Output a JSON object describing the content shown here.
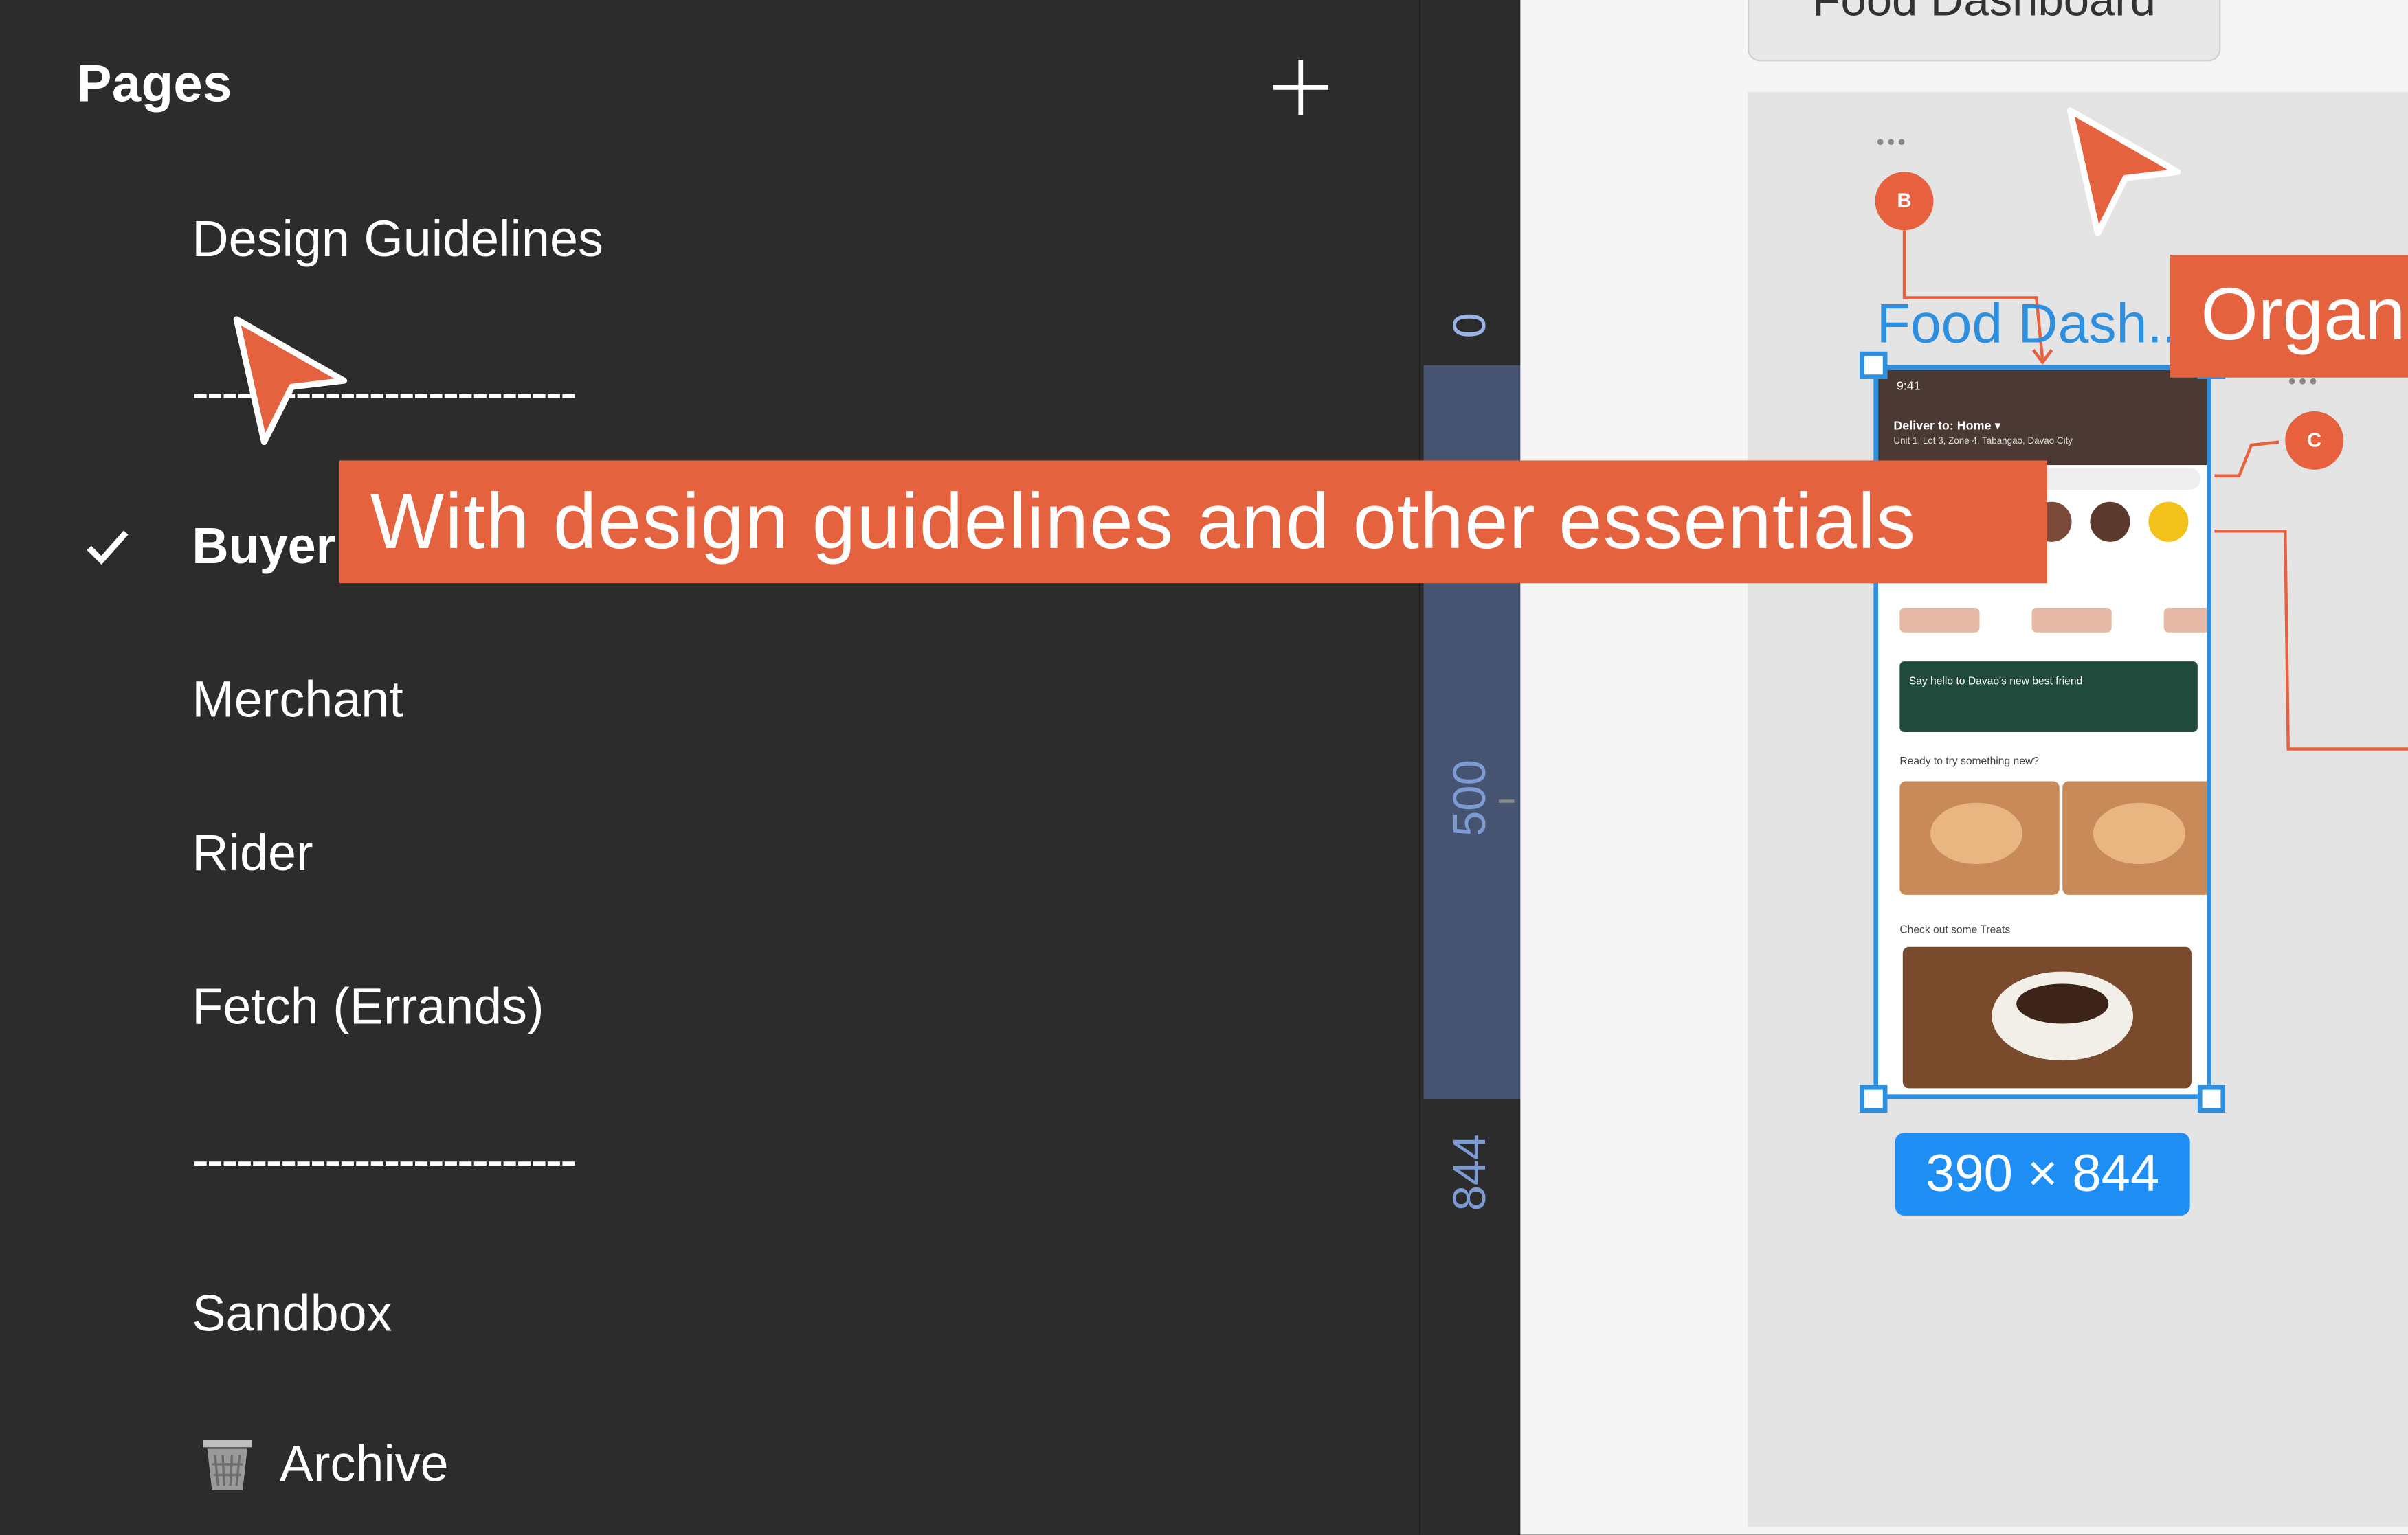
{
  "sidebar": {
    "title": "Pages",
    "add_icon": "plus-icon",
    "items": [
      {
        "label": "Design Guidelines",
        "type": "page",
        "selected": false
      },
      {
        "label": "--------------------------",
        "type": "separator"
      },
      {
        "label": "Buyer",
        "type": "page",
        "selected": true
      },
      {
        "label": "Merchant",
        "type": "page",
        "selected": false
      },
      {
        "label": "Rider",
        "type": "page",
        "selected": false
      },
      {
        "label": "Fetch (Errands)",
        "type": "page",
        "selected": false
      },
      {
        "label": "--------------------------",
        "type": "separator"
      },
      {
        "label": "Sandbox",
        "type": "page",
        "selected": false
      },
      {
        "label": "Archive",
        "type": "page",
        "icon": "trash-icon",
        "selected": false
      }
    ]
  },
  "ruler": {
    "marks": [
      "0",
      "500",
      "844"
    ],
    "highlight_color": "#475471"
  },
  "canvas": {
    "section_label": "Food Dashboard",
    "frame_name": "Food Dash...",
    "dimensions": "390 × 844",
    "comment_pins": [
      "B",
      "C"
    ],
    "phone": {
      "status_time": "9:41",
      "deliver_to": "Deliver to: Home ▾",
      "address": "Unit 1, Lot 3, Zone 4, Tabangao, Davao City",
      "banner": "Say hello to Davao's new best friend",
      "section_1": "Ready to try something new?",
      "section_2": "Check out some Treats"
    }
  },
  "overlays": {
    "callout_main": "With design guidelines and other essentials",
    "callout_side": "Organ",
    "accent": "#e5623f",
    "selection_blue": "#2c8fe0"
  }
}
